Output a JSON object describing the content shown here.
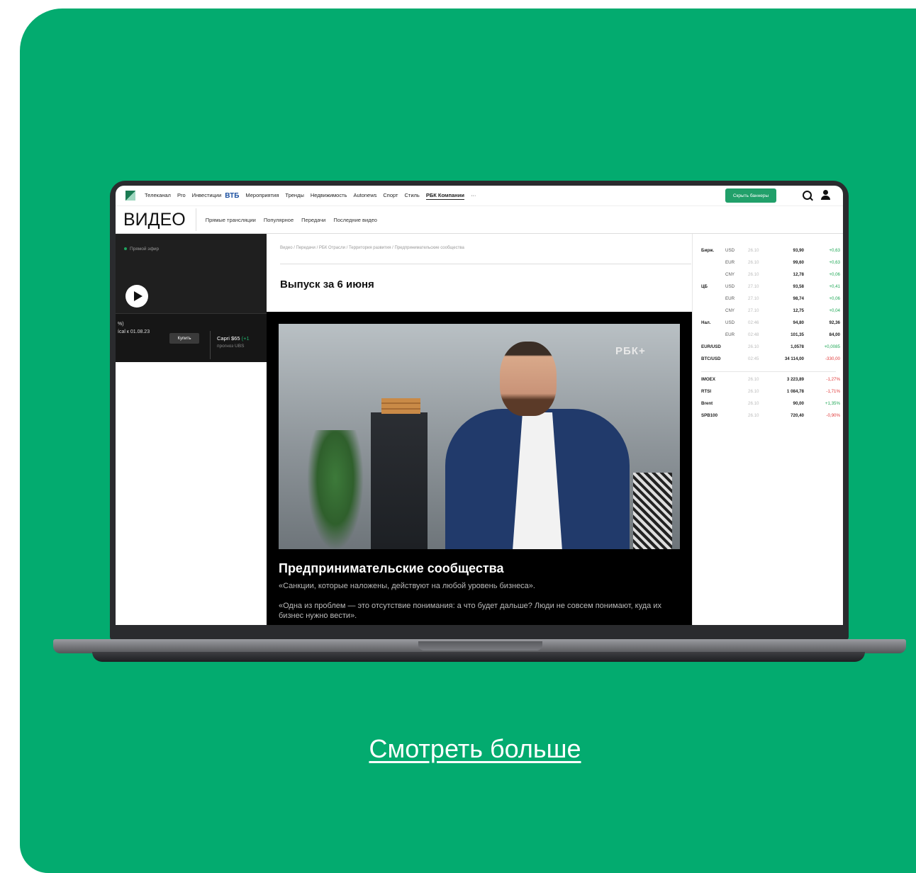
{
  "topnav": {
    "items": [
      "Телеканал",
      "Pro",
      "Инвестиции",
      "ВТБ",
      "Мероприятия",
      "Тренды",
      "Недвижимость",
      "Autonews",
      "Спорт",
      "Стиль",
      "РБК Компании",
      "···"
    ],
    "hide_banners": "Скрыть баннеры"
  },
  "subnav": {
    "title": "ВИДЕО",
    "items": [
      "Прямые трансляции",
      "Популярное",
      "Передачи",
      "Последние видео"
    ]
  },
  "live": {
    "label": "Прямой эфир"
  },
  "promo": {
    "left_line1": "%)",
    "left_line2": "ícal к 01.08.23",
    "buy": "Купить",
    "right_line1a": "Capri $65 ",
    "right_line1b": "(+1",
    "right_line2": "прогноз UBS"
  },
  "content": {
    "breadcrumb": "Видео / Передачи / РБК Отрасли / Территория развития / Предпринимательские сообщества",
    "episode": "Выпуск за 6 июня",
    "watermark": "РБК+",
    "heading": "Предпринимательские сообщества",
    "quote1": "«Санкции, которые наложены, действуют на любой уровень бизнеса».",
    "quote2": "«Одна из проблем — это отсутствие понимания: а что будет дальше? Люди не совсем понимают, куда их бизнес нужно вести»."
  },
  "market": {
    "rows": [
      {
        "group": "Бирж.",
        "cur": "USD",
        "date": "26.10",
        "value": "93,90",
        "change": "+0,63",
        "dir": "up"
      },
      {
        "group": "",
        "cur": "EUR",
        "date": "26.10",
        "value": "99,60",
        "change": "+0,63",
        "dir": "up"
      },
      {
        "group": "",
        "cur": "CNY",
        "date": "26.10",
        "value": "12,78",
        "change": "+0,06",
        "dir": "up"
      },
      {
        "group": "ЦБ",
        "cur": "USD",
        "date": "27.10",
        "value": "93,58",
        "change": "+0,41",
        "dir": "up"
      },
      {
        "group": "",
        "cur": "EUR",
        "date": "27.10",
        "value": "98,74",
        "change": "+0,06",
        "dir": "up"
      },
      {
        "group": "",
        "cur": "CNY",
        "date": "27.10",
        "value": "12,75",
        "change": "+0,04",
        "dir": "up"
      },
      {
        "group": "Нал.",
        "cur": "USD",
        "date": "02:46",
        "value": "94,80",
        "change": "92,36",
        "dir": "plain"
      },
      {
        "group": "",
        "cur": "EUR",
        "date": "02:48",
        "value": "101,35",
        "change": "84,00",
        "dir": "plain"
      },
      {
        "group": "EUR/USD",
        "cur": "",
        "date": "26.10",
        "value": "1,0578",
        "change": "+0,0085",
        "dir": "up"
      },
      {
        "group": "BTC/USD",
        "cur": "",
        "date": "02:45",
        "value": "34 114,00",
        "change": "-330,00",
        "dir": "down"
      },
      {
        "group": "IMOEX",
        "cur": "",
        "date": "26.10",
        "value": "3 223,89",
        "change": "-1,27%",
        "dir": "down"
      },
      {
        "group": "RTSI",
        "cur": "",
        "date": "26.10",
        "value": "1 084,78",
        "change": "-1,71%",
        "dir": "down"
      },
      {
        "group": "Brent",
        "cur": "",
        "date": "26.10",
        "value": "90,00",
        "change": "+1,35%",
        "dir": "up"
      },
      {
        "group": "SPB100",
        "cur": "",
        "date": "26.10",
        "value": "720,40",
        "change": "-0,90%",
        "dir": "down"
      }
    ]
  },
  "see_more": "Смотреть больше",
  "colors": {
    "background": "#03ab6f",
    "accent": "#21a06a",
    "up": "#21a857",
    "down": "#e03a3a"
  }
}
